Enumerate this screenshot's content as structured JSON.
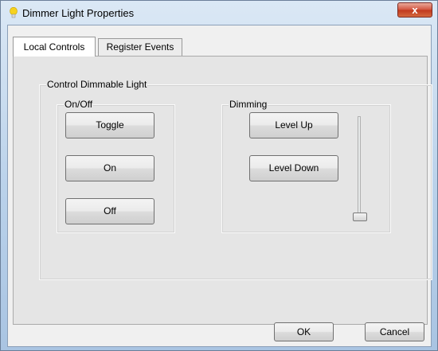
{
  "window": {
    "title": "Dimmer Light Properties",
    "close_label": "x"
  },
  "tabs": [
    {
      "label": "Local Controls",
      "selected": true
    },
    {
      "label": "Register Events",
      "selected": false
    }
  ],
  "group_main": {
    "label": "Control Dimmable Light"
  },
  "group_onoff": {
    "label": "On/Off",
    "buttons": [
      "Toggle",
      "On",
      "Off"
    ]
  },
  "group_dimming": {
    "label": "Dimming",
    "buttons": [
      "Level Up",
      "Level Down"
    ],
    "slider_level": 0
  },
  "footer": {
    "ok_label": "OK",
    "cancel_label": "Cancel"
  },
  "colors": {
    "close_button": "#c8402a",
    "icon": "#f2c81c"
  }
}
